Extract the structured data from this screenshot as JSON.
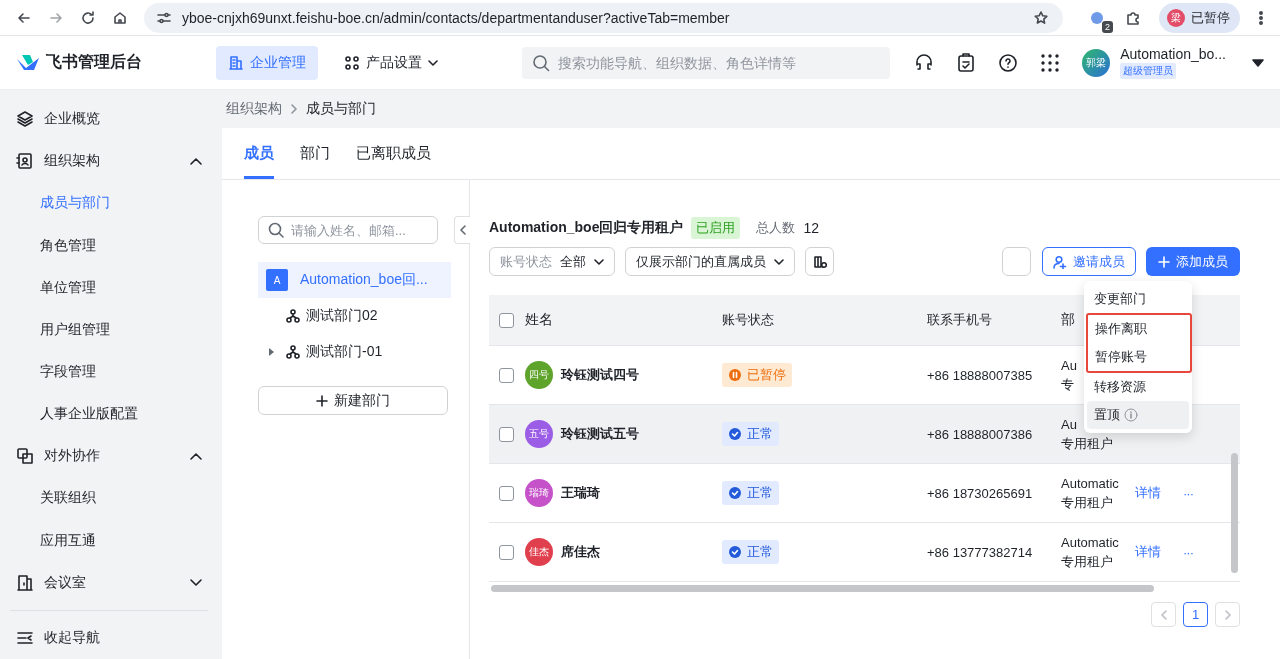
{
  "browser": {
    "url": "yboe-cnjxh69unxt.feishu-boe.cn/admin/contacts/departmentanduser?activeTab=member",
    "extension_badge": "2",
    "profile": {
      "avatar": "梁",
      "label": "已暂停"
    }
  },
  "header": {
    "app_title": "飞书管理后台",
    "nav": [
      {
        "label": "企业管理",
        "selected": true,
        "dropdown": false
      },
      {
        "label": "产品设置",
        "selected": false,
        "dropdown": true
      }
    ],
    "search": {
      "placeholder": "搜索功能导航、组织数据、角色详情等"
    },
    "user": {
      "avatar": "郭梁",
      "name": "Automation_bo...",
      "role": "超级管理员"
    }
  },
  "sidebar": {
    "items": [
      {
        "label": "企业概览",
        "selected": false
      },
      {
        "label": "组织架构",
        "selected": false,
        "expanded": true,
        "children": [
          {
            "label": "成员与部门",
            "selected": true
          },
          {
            "label": "角色管理",
            "selected": false
          },
          {
            "label": "单位管理",
            "selected": false
          },
          {
            "label": "用户组管理",
            "selected": false
          },
          {
            "label": "字段管理",
            "selected": false
          },
          {
            "label": "人事企业版配置",
            "selected": false
          }
        ]
      },
      {
        "label": "对外协作",
        "selected": false,
        "expanded": true,
        "children": [
          {
            "label": "关联组织",
            "selected": false
          },
          {
            "label": "应用互通",
            "selected": false
          }
        ]
      },
      {
        "label": "会议室",
        "selected": false,
        "expanded": false
      }
    ],
    "collapse": "收起导航"
  },
  "breadcrumb": [
    "组织架构",
    "成员与部门"
  ],
  "tabs": [
    {
      "label": "成员",
      "selected": true
    },
    {
      "label": "部门",
      "selected": false
    },
    {
      "label": "已离职成员",
      "selected": false
    }
  ],
  "department_tree": {
    "search": {
      "placeholder": "请输入姓名、邮箱..."
    },
    "items": [
      {
        "label": "Automation_boe回...",
        "badge": "A",
        "selected": true,
        "children": [
          {
            "label": "测试部门02",
            "selected": false,
            "expandable": false
          },
          {
            "label": "测试部门-01",
            "selected": false,
            "expandable": true
          }
        ]
      }
    ],
    "new_button": "新建部门"
  },
  "members": {
    "title": "Automation_boe回归专用租户",
    "status": "已启用",
    "total_label": "总人数",
    "total": "12",
    "filters": [
      {
        "label": "账号状态",
        "value": "全部"
      },
      {
        "value": "仅展示部门的直属成员"
      }
    ],
    "buttons": [
      {
        "kind": "blank"
      },
      {
        "kind": "outline",
        "label": "邀请成员"
      },
      {
        "kind": "primary",
        "label": "添加成员"
      }
    ],
    "all_checked": false,
    "columns": [
      "姓名",
      "账号状态",
      "联系手机号",
      "部"
    ],
    "rows": [
      {
        "checked": false,
        "hovered": false,
        "avatar": "四号",
        "color": "#5ea32a",
        "name": "玲钰测试四号",
        "status": {
          "kind": "paused",
          "label": "已暂停"
        },
        "phone": "+86 18888007385",
        "department": [
          "Au",
          "专"
        ]
      },
      {
        "checked": false,
        "hovered": true,
        "avatar": "五号",
        "color": "#9b5de5",
        "name": "玲钰测试五号",
        "status": {
          "kind": "normal",
          "label": "正常"
        },
        "phone": "+86 18888007386",
        "department": [
          "Au",
          "专用租户"
        ]
      },
      {
        "checked": false,
        "hovered": false,
        "avatar": "瑞琦",
        "color": "#c552c9",
        "name": "王瑞琦",
        "status": {
          "kind": "normal",
          "label": "正常"
        },
        "phone": "+86 18730265691",
        "department": [
          "Automatic",
          "专用租户"
        ],
        "actions": [
          "详情",
          "···"
        ]
      },
      {
        "checked": false,
        "hovered": false,
        "avatar": "佳杰",
        "color": "#e0404e",
        "name": "席佳杰",
        "status": {
          "kind": "normal",
          "label": "正常"
        },
        "phone": "+86 13777382714",
        "department": [
          "Automatic",
          "专用租户"
        ],
        "actions": [
          "详情",
          "···"
        ]
      }
    ],
    "menu": {
      "items": [
        {
          "label": "变更部门",
          "framed": false,
          "hovered": false,
          "info": false
        },
        {
          "label": "操作离职",
          "framed": true,
          "hovered": false,
          "info": false
        },
        {
          "label": "暂停账号",
          "framed": true,
          "hovered": false,
          "info": false
        },
        {
          "label": "转移资源",
          "framed": false,
          "hovered": false,
          "info": false
        },
        {
          "label": "置顶",
          "framed": false,
          "hovered": true,
          "info": true
        }
      ]
    },
    "pagination": {
      "pages": [
        {
          "label": "1",
          "selected": true
        }
      ]
    }
  }
}
